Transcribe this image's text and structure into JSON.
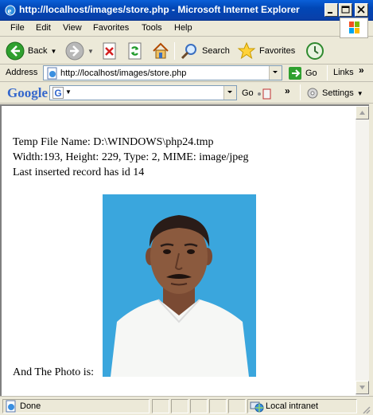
{
  "window": {
    "title": "http://localhost/images/store.php - Microsoft Internet Explorer"
  },
  "menu": {
    "items": [
      "File",
      "Edit",
      "View",
      "Favorites",
      "Tools",
      "Help"
    ]
  },
  "toolbar": {
    "back_label": "Back",
    "search_label": "Search",
    "favorites_label": "Favorites"
  },
  "address": {
    "label": "Address",
    "url": "http://localhost/images/store.php",
    "go_label": "Go",
    "links_label": "Links"
  },
  "google": {
    "logo": "Google",
    "go_label": "Go",
    "settings_label": "Settings"
  },
  "page": {
    "line1": "Temp File Name: D:\\WINDOWS\\php24.tmp",
    "line2": "Width:193, Height: 229, Type: 2, MIME: image/jpeg",
    "line3": "Last inserted record has id 14",
    "photo_caption": "And The Photo is:"
  },
  "status": {
    "text": "Done",
    "zone": "Local intranet"
  },
  "colors": {
    "titlebar": "#0a5fd8",
    "photo_background": "#3aa6dd"
  }
}
